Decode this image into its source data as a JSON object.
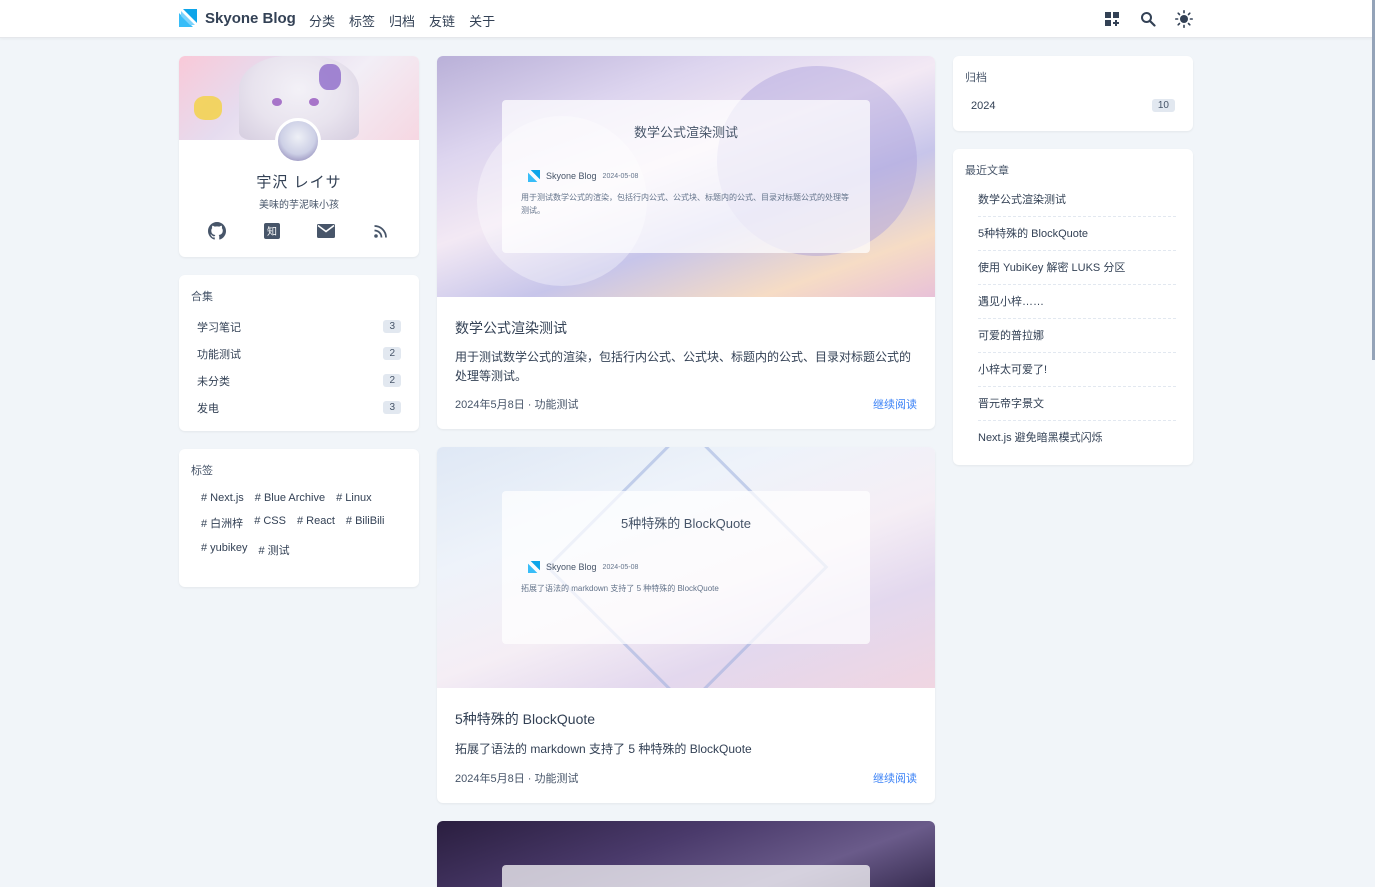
{
  "header": {
    "brand": "Skyone Blog",
    "nav": [
      "分类",
      "标签",
      "归档",
      "友链",
      "关于"
    ],
    "icons": [
      "grid-add-icon",
      "search-icon",
      "sun-icon"
    ]
  },
  "profile": {
    "name": "宇沢 レイサ",
    "bio": "美味的芋泥味小孩",
    "social": [
      "github-icon",
      "zhihu-icon",
      "mail-icon",
      "rss-icon"
    ],
    "zhihu_glyph": "知"
  },
  "collections": {
    "title": "合集",
    "items": [
      {
        "label": "学习笔记",
        "count": "3"
      },
      {
        "label": "功能测试",
        "count": "2"
      },
      {
        "label": "未分类",
        "count": "2"
      },
      {
        "label": "发电",
        "count": "3"
      }
    ]
  },
  "tags": {
    "title": "标签",
    "items": [
      "# Next.js",
      "# Blue Archive",
      "# Linux",
      "# 白洲梓",
      "# CSS",
      "# React",
      "# BiliBili",
      "# yubikey",
      "# 测试"
    ]
  },
  "posts": [
    {
      "cover_title": "数学公式渲染测试",
      "cover_brand": "Skyone Blog",
      "cover_date": "2024-05-08",
      "cover_desc": "用于测试数学公式的渲染，包括行内公式、公式块、标题内的公式、目录对标题公式的处理等测试。",
      "title": "数学公式渲染测试",
      "desc": "用于测试数学公式的渲染，包括行内公式、公式块、标题内的公式、目录对标题公式的处理等测试。",
      "meta": "2024年5月8日 · 功能测试",
      "more": "继续阅读"
    },
    {
      "cover_title": "5种特殊的 BlockQuote",
      "cover_brand": "Skyone Blog",
      "cover_date": "2024-05-08",
      "cover_desc": "拓展了语法的 markdown 支持了 5 种特殊的 BlockQuote",
      "title": "5种特殊的 BlockQuote",
      "desc": "拓展了语法的 markdown 支持了 5 种特殊的 BlockQuote",
      "meta": "2024年5月8日 · 功能测试",
      "more": "继续阅读"
    }
  ],
  "archive": {
    "title": "归档",
    "year": "2024",
    "count": "10"
  },
  "recent": {
    "title": "最近文章",
    "items": [
      "数学公式渲染测试",
      "5种特殊的 BlockQuote",
      "使用 YubiKey 解密 LUKS 分区",
      "遇见小梓……",
      "可爱的普拉娜",
      "小梓太可爱了!",
      "晋元帝字景文",
      "Next.js 避免暗黑模式闪烁"
    ]
  }
}
